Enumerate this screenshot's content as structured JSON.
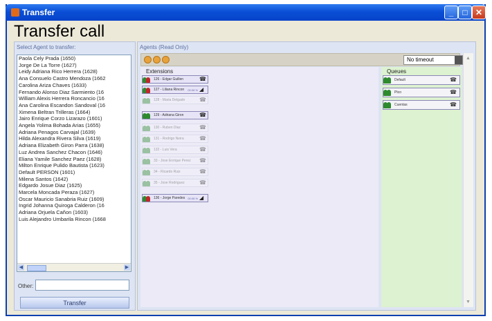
{
  "window": {
    "title": "Transfer"
  },
  "page_title": "Transfer call",
  "left_panel": {
    "label": "Select Agent to transfer:",
    "agents": [
      "Paola Cely Prada (1650)",
      "Jorge De La Torre (1627)",
      "Leidy Adriana Rico Herrera (1628)",
      "Ana Consuelo Castro Mendoza (1662",
      "Carolina Ariza Chaves (1633)",
      "Fernando Alonso Diaz Sarmiento (16",
      "William Alexis Herrera Roncancio (16",
      "Ana Carolina Escandon Sandoval (16",
      "Ximena Beltran Trilleras (1664)",
      "Jairo Enrique Corzo Lizarazo (1601)",
      "Angela Yolima Bohada Arias (1655)",
      "Adriana Penagos Carvajal (1639)",
      "Hilda Alexandra Rivera Silva (1619)",
      "Adriana Elizabeth Giron Parra (1638)",
      "Luz Andrea Sanchez Chacon (1646)",
      "Eliana Yamile Sanchez Paez (1628)",
      "Milton Enrique Pulido Bautista (1623)",
      "Default PERSON (1601)",
      "Milena Santos (1642)",
      "Edgardo Josue Diaz (1625)",
      "Marcela Moncada Peraza (1627)",
      "Oscar Mauricio Sanabria Ruiz (1609)",
      "Ingrid Johanna Quiroga Calderon (16",
      "Adriana Orjuela Cañon (1603)",
      "Luis Alejandro Umbarila Rincon (1668"
    ],
    "other_label": "Other:",
    "other_value": "",
    "transfer_label": "Transfer"
  },
  "right_panel": {
    "label": "Agents (Read Only)",
    "timeout": "No timeout",
    "extensions_label": "Extensions",
    "queues_label": "Queues",
    "extensions": [
      {
        "text": "126 - Edgar Guillen",
        "state": "active",
        "color": "red",
        "pct": "",
        "icon": "phone-icon"
      },
      {
        "text": "127 - Liliana Rincon",
        "state": "active",
        "color": "red",
        "pct": "00:08 %",
        "icon": "phone-off-hook-icon"
      },
      {
        "text": "128 - Maria Delgado",
        "state": "dim",
        "color": "green",
        "pct": "",
        "icon": "phone-icon"
      },
      {
        "text": "129 - Adriana Giron",
        "state": "active",
        "color": "green",
        "pct": "",
        "icon": "phone-icon"
      },
      {
        "text": "130 - Ruben Diaz",
        "state": "dim",
        "color": "green",
        "pct": "",
        "icon": "phone-icon"
      },
      {
        "text": "131 - Rodrigo Neira",
        "state": "dim",
        "color": "green",
        "pct": "",
        "icon": "phone-icon"
      },
      {
        "text": "132 - Luis Vera",
        "state": "dim",
        "color": "green",
        "pct": "",
        "icon": "phone-icon"
      },
      {
        "text": "33 - Jose Enrique Perez",
        "state": "dim",
        "color": "green",
        "pct": "",
        "icon": "phone-icon"
      },
      {
        "text": "34 - Ricardo Ruiz",
        "state": "dim",
        "color": "green",
        "pct": "",
        "icon": "phone-icon"
      },
      {
        "text": "35 - Jose Rodriguez",
        "state": "dim",
        "color": "green",
        "pct": "",
        "icon": "phone-icon"
      },
      {
        "text": "136 - Jorge Paredes",
        "state": "active",
        "color": "red",
        "pct": "00:08 %",
        "icon": "phone-off-hook-icon"
      }
    ],
    "queues": [
      {
        "text": "Default"
      },
      {
        "text": "Ptco"
      },
      {
        "text": "Cuentas"
      }
    ]
  }
}
